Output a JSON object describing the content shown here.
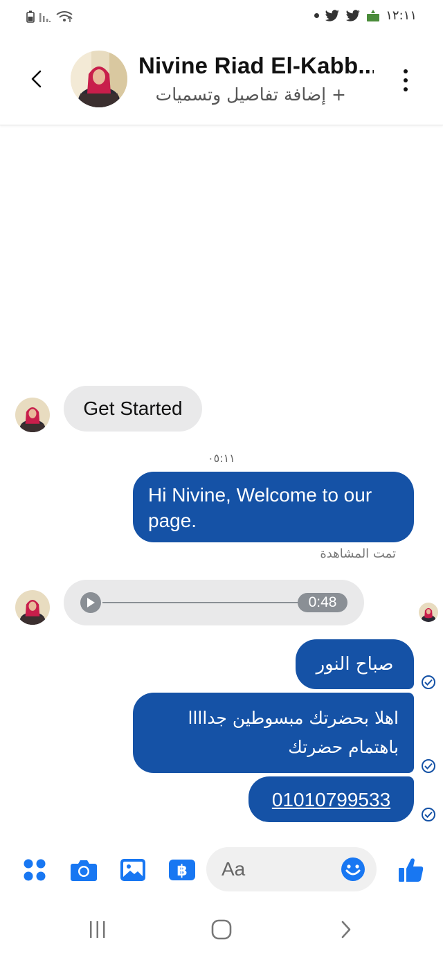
{
  "status_bar": {
    "time": "١٢:١١"
  },
  "header": {
    "contact_name": "Nivine Riad El-Kabb...",
    "subtitle": "+ إضافة تفاصيل وتسميات"
  },
  "messages": {
    "incoming_get_started": "Get Started",
    "timestamp": "٠٥:١١",
    "outgoing_welcome": "Hi Nivine, Welcome to our page.",
    "seen_label": "تمت المشاهدة",
    "audio_duration": "0:48",
    "outgoing_morning": "صباح النور",
    "outgoing_happy_line1": "اهلا بحضرتك مبسوطين جداااا",
    "outgoing_happy_line2": "باهتمام حضرتك",
    "outgoing_phone": "01010799533"
  },
  "composer": {
    "placeholder": "Aa"
  },
  "colors": {
    "accent": "#1552a6",
    "icon_blue": "#1877f2",
    "incoming_bubble": "#e9e9ea"
  }
}
